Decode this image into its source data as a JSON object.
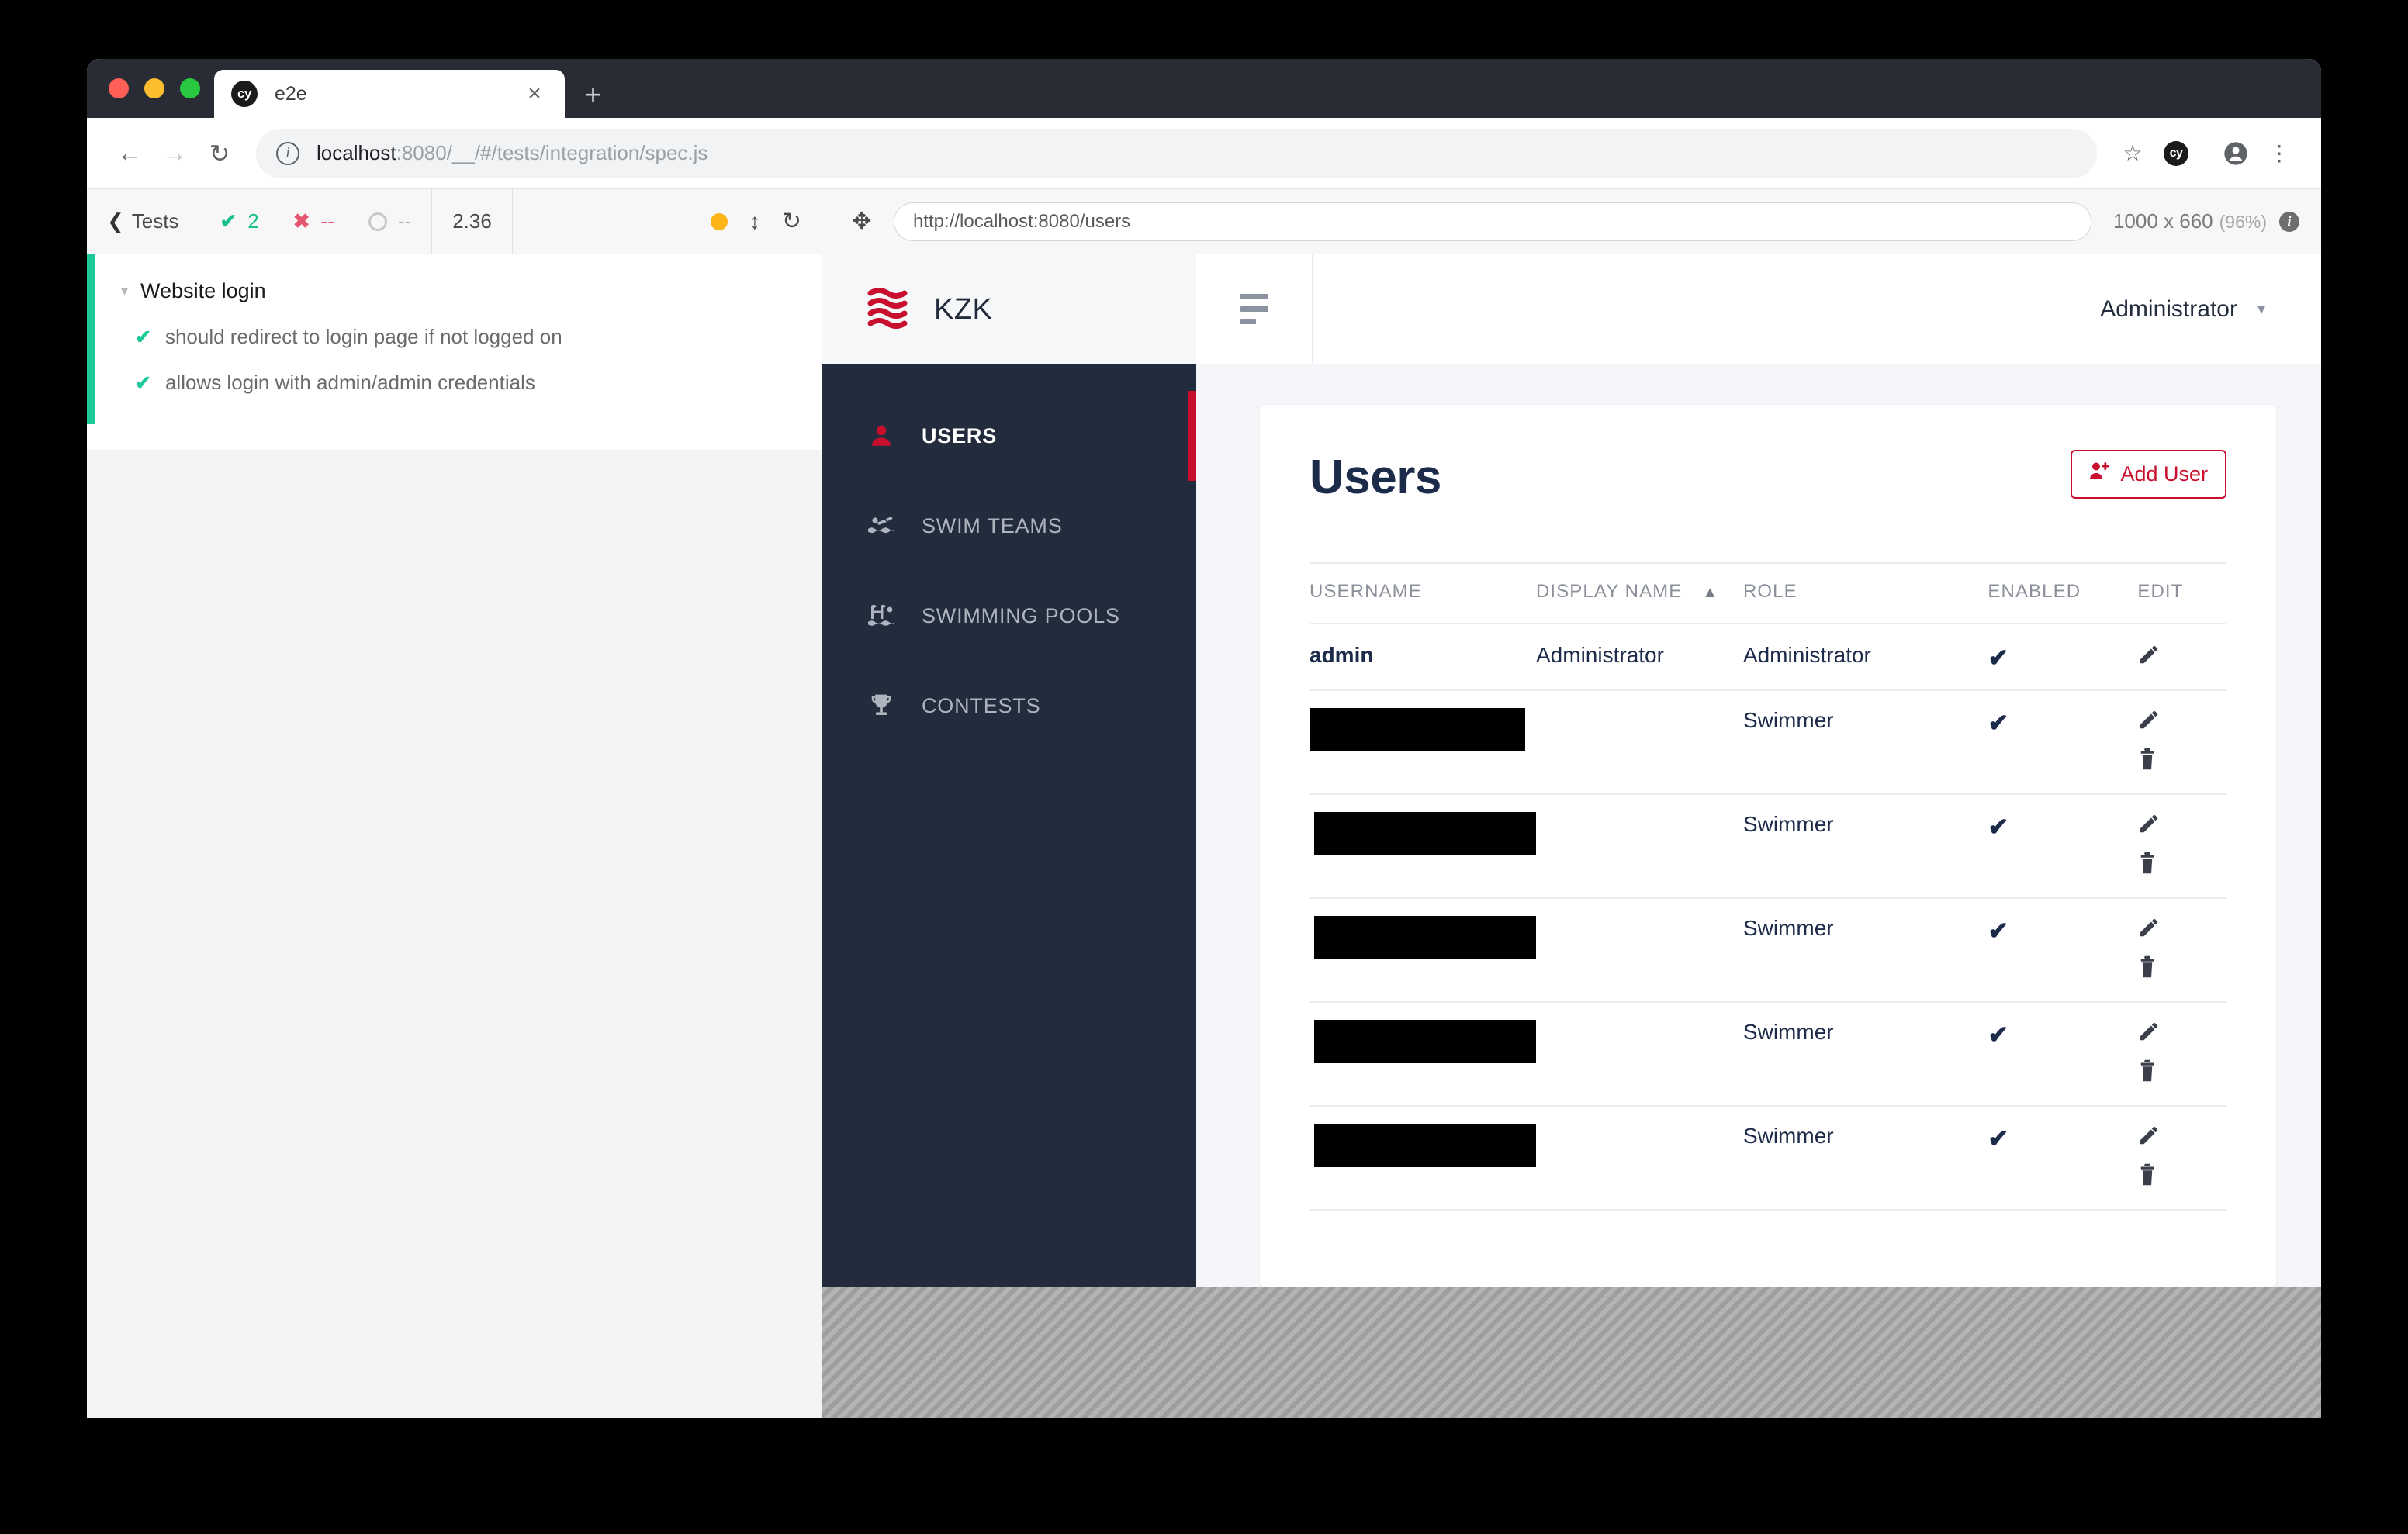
{
  "browser": {
    "tab": {
      "title": "e2e",
      "favicon_label": "cy",
      "close_label": "×"
    },
    "new_tab_label": "+",
    "nav": {
      "back": "←",
      "forward": "→",
      "reload": "↻"
    },
    "omnibox": {
      "info_icon": "i",
      "url_host": "localhost",
      "url_rest": ":8080/__/#/tests/integration/spec.js"
    },
    "actions": {
      "star": "☆",
      "extension_label": "cy",
      "profile": "●",
      "menu": "⋮"
    }
  },
  "cypress": {
    "back_label": "Tests",
    "back_chevron": "❮",
    "stats": {
      "passed": "2",
      "failed": "--",
      "pending": "--",
      "duration": "2.36"
    },
    "controls": {
      "updown": "↕",
      "reload": "↻"
    },
    "suite": {
      "title": "Website login",
      "caret": "▾",
      "tests": [
        {
          "tick": "✔",
          "label": "should redirect to login page if not logged on"
        },
        {
          "tick": "✔",
          "label": "allows login with admin/admin credentials"
        }
      ]
    },
    "preview": {
      "move_icon": "✥",
      "url": "http://localhost:8080/users",
      "viewport": "1000 x 660",
      "zoom": "(96%)",
      "info": "i"
    }
  },
  "app": {
    "brand": "KZK",
    "nav": [
      {
        "label": "USERS",
        "icon": "user-icon",
        "active": true
      },
      {
        "label": "SWIM TEAMS",
        "icon": "swimmer-icon",
        "active": false
      },
      {
        "label": "SWIMMING POOLS",
        "icon": "pool-icon",
        "active": false
      },
      {
        "label": "CONTESTS",
        "icon": "trophy-icon",
        "active": false
      }
    ],
    "topbar": {
      "user": "Administrator",
      "caret": "▾"
    },
    "page": {
      "title": "Users",
      "add_button": "Add User"
    },
    "table": {
      "columns": [
        "USERNAME",
        "DISPLAY NAME",
        "ROLE",
        "ENABLED",
        "EDIT"
      ],
      "sort_indicator": "▲",
      "sort_column": "DISPLAY NAME",
      "rows": [
        {
          "username": "admin",
          "username_redacted": false,
          "display_name": "Administrator",
          "display_redacted": false,
          "role": "Administrator",
          "enabled": "✔",
          "actions": [
            "edit"
          ]
        },
        {
          "username": "",
          "username_redacted": true,
          "redact_width": 278,
          "display_name": "",
          "display_redacted": true,
          "role": "Swimmer",
          "enabled": "✔",
          "actions": [
            "edit",
            "delete"
          ]
        },
        {
          "username": "",
          "username_redacted": true,
          "redact_width": 286,
          "display_name": "",
          "display_redacted": true,
          "role": "Swimmer",
          "enabled": "✔",
          "actions": [
            "edit",
            "delete"
          ]
        },
        {
          "username": "",
          "username_redacted": true,
          "redact_width": 286,
          "display_name": "",
          "display_redacted": true,
          "role": "Swimmer",
          "enabled": "✔",
          "actions": [
            "edit",
            "delete"
          ]
        },
        {
          "username": "",
          "username_redacted": true,
          "redact_width": 286,
          "display_name": "",
          "display_redacted": true,
          "role": "Swimmer",
          "enabled": "✔",
          "actions": [
            "edit",
            "delete"
          ]
        },
        {
          "username": "",
          "username_redacted": true,
          "redact_width": 286,
          "display_name": "",
          "display_redacted": true,
          "role": "Swimmer",
          "enabled": "✔",
          "actions": [
            "edit",
            "delete"
          ]
        }
      ]
    }
  },
  "colors": {
    "brand_red": "#c8102e",
    "sidebar_dark": "#222c3d",
    "pass_green": "#1ec99a",
    "fail_red": "#e45770",
    "amber": "#fdb417"
  }
}
